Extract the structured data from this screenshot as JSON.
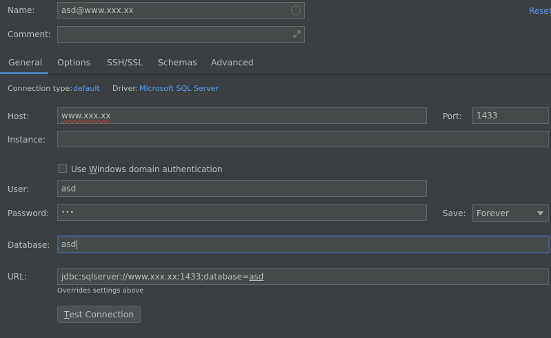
{
  "name": {
    "label": "Name:",
    "value": "asd@www.xxx.xx"
  },
  "reset_label": "Reset",
  "comment": {
    "label": "Comment:",
    "value": ""
  },
  "tabs": [
    {
      "label": "General"
    },
    {
      "label": "Options"
    },
    {
      "label": "SSH/SSL"
    },
    {
      "label": "Schemas"
    },
    {
      "label": "Advanced"
    }
  ],
  "connection_type": {
    "label": "Connection type:",
    "value": "default"
  },
  "driver": {
    "label": "Driver:",
    "value": "Microsoft SQL Server"
  },
  "host": {
    "label": "Host:",
    "value": "www.xxx.xx"
  },
  "port": {
    "label": "Port:",
    "value": "1433"
  },
  "instance": {
    "label": "Instance:",
    "value": ""
  },
  "windows_auth": {
    "label_pre": "Use ",
    "label_mnemonic": "W",
    "label_post": "indows domain authentication",
    "checked": false
  },
  "user": {
    "label": "User:",
    "value": "asd"
  },
  "password": {
    "label": "Password:",
    "value": "•••"
  },
  "save": {
    "label": "Save:",
    "value": "Forever"
  },
  "database": {
    "label": "Database:",
    "value": "asd"
  },
  "url": {
    "label": "URL:",
    "value_prefix": "jdbc:sqlserver://www.xxx.xx:1433;database=",
    "value_db": "asd",
    "hint": "Overrides settings above"
  },
  "test_connection": {
    "mnemonic": "T",
    "rest": "est Connection"
  },
  "colors": {
    "background": "#3c3f41",
    "field": "#45494a",
    "link": "#589df6",
    "accent": "#4a88c7"
  }
}
